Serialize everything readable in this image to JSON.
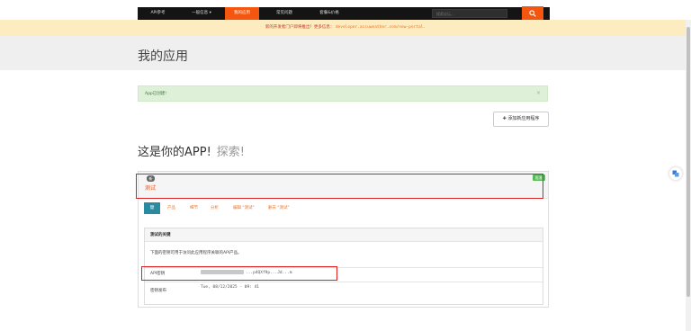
{
  "nav": {
    "items": [
      {
        "label": "API参考"
      },
      {
        "label": "一般信息 ▾"
      },
      {
        "label": "我的应用"
      },
      {
        "label": "常见问题"
      },
      {
        "label": "套餐&价格"
      }
    ],
    "search_placeholder": "搜索论坛..."
  },
  "notice": {
    "text": "新的开发者门户即将推出！更多信息：",
    "link": "developer.accuweather.com/new-portal."
  },
  "page_title": "我的应用",
  "alert": {
    "text": "App已创建!",
    "close": "×"
  },
  "add_button": {
    "plus": "✚",
    "label": "添加新应用程序"
  },
  "section": {
    "title": "这是你的APP!",
    "subtitle": "探索!"
  },
  "app": {
    "badge": "新",
    "name": "测试",
    "status": "批准",
    "tabs": [
      {
        "label": "键"
      },
      {
        "label": "产品"
      },
      {
        "label": "细节"
      },
      {
        "label": "分析"
      },
      {
        "label": "编辑 \"测试\""
      },
      {
        "label": "删去 \"测试\""
      }
    ],
    "keys": {
      "heading": "测试的关键",
      "description": "下面的密钥可用于访问此应用程序关联的API产品。",
      "api_key_label": "API密钥",
      "api_key_value": "...p4QXf9p...Jd...m",
      "issued_label": "密钥发布",
      "issued_value": "Tue, 08/12/2025 - 09: 41"
    }
  }
}
